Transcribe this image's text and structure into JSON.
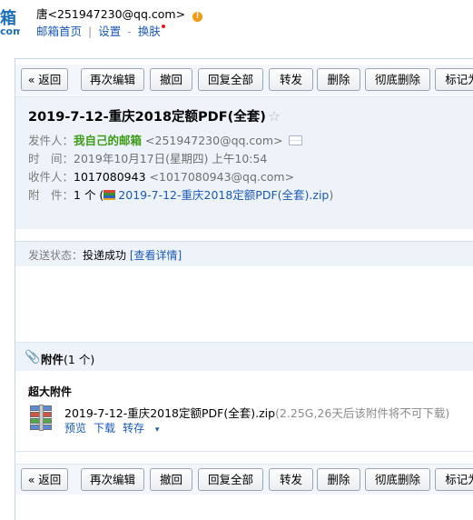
{
  "logo": {
    "main": "箱",
    "sub": "com"
  },
  "header": {
    "user": "唐<251947230@qq.com>",
    "links": {
      "home": "邮箱首页",
      "separator": "|",
      "settings": "设置",
      "dash": "-",
      "skin": "换肤"
    }
  },
  "toolbar": {
    "buttons": [
      {
        "label": "« 返回"
      },
      {
        "label": "再次编辑"
      },
      {
        "label": "撤回"
      },
      {
        "label": "回复全部"
      },
      {
        "label": "转发"
      },
      {
        "label": "删除"
      },
      {
        "label": "彻底删除"
      },
      {
        "label": "标记为"
      }
    ]
  },
  "mail": {
    "subject": "2019-7-12-重庆2018定额PDF(全套)",
    "star": "☆",
    "from": {
      "label": "发件人：",
      "name": "我自己的邮箱",
      "email": "<251947230@qq.com>"
    },
    "time": {
      "label": "时　间：",
      "value": "2019年10月17日(星期四) 上午10:54"
    },
    "to": {
      "label": "收件人：",
      "name": "1017080943",
      "email": "<1017080943@qq.com>"
    },
    "attachment": {
      "label": "附　件：",
      "count": "1 个 (",
      "file": "2019-7-12-重庆2018定额PDF(全套).zip",
      "close": ")"
    },
    "status": {
      "label": "发送状态：",
      "value": "投递成功",
      "details": "[查看详情]"
    }
  },
  "attachments": {
    "clip_icon": "paperclip-icon",
    "title": "附件",
    "count": "(1 个)",
    "section": "超大附件",
    "file": {
      "name": "2019-7-12-重庆2018定额PDF(全套).zip",
      "note": "(2.25G,26天后该附件将不可下载)",
      "actions": {
        "preview": "预览",
        "download": "下载",
        "save": "转存",
        "caret": "▾"
      }
    }
  },
  "colors": {
    "accent": "#1a59b5",
    "sender": "#3c9c18",
    "panel_bg": "#eef3fa",
    "border": "#c7d5e6"
  }
}
